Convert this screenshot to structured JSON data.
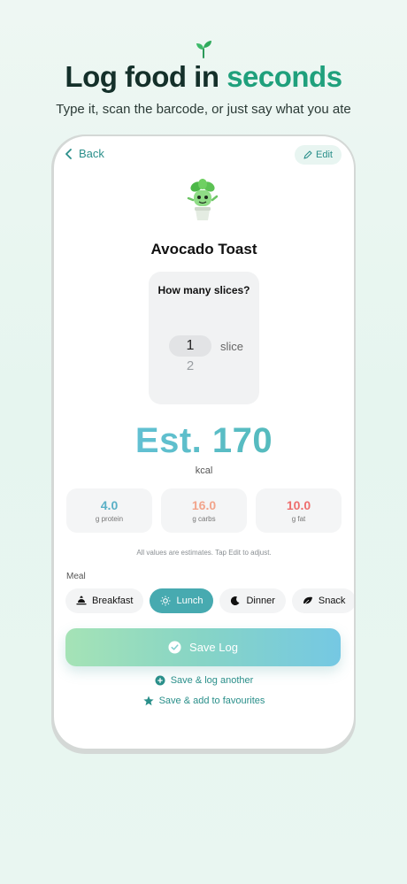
{
  "hero": {
    "title_part1": "Log food in ",
    "title_accent": "seconds",
    "subtitle": "Type it, scan the barcode, or just say what you ate"
  },
  "nav": {
    "back_label": "Back",
    "edit_label": "Edit"
  },
  "food": {
    "name": "Avocado Toast"
  },
  "portion": {
    "question": "How many slices?",
    "selected": "1",
    "next_option": "2",
    "unit": "slice"
  },
  "calories": {
    "estimate": "Est. 170",
    "unit": "kcal"
  },
  "macros": [
    {
      "value": "4.0",
      "label": "g protein",
      "color": "#5ab0c6"
    },
    {
      "value": "16.0",
      "label": "g carbs",
      "color": "#f2a48b"
    },
    {
      "value": "10.0",
      "label": "g fat",
      "color": "#ee6d6d"
    }
  ],
  "disclaimer": "All values are estimates. Tap Edit to adjust.",
  "meal": {
    "label": "Meal",
    "options": [
      "Breakfast",
      "Lunch",
      "Dinner",
      "Snack"
    ],
    "selected": "Lunch"
  },
  "actions": {
    "save": "Save Log",
    "save_another": "Save & log another",
    "save_favourite": "Save & add to favourites"
  },
  "colors": {
    "accent": "#1fa07c",
    "link": "#2a8f8a",
    "chip_active": "#47aab0"
  }
}
